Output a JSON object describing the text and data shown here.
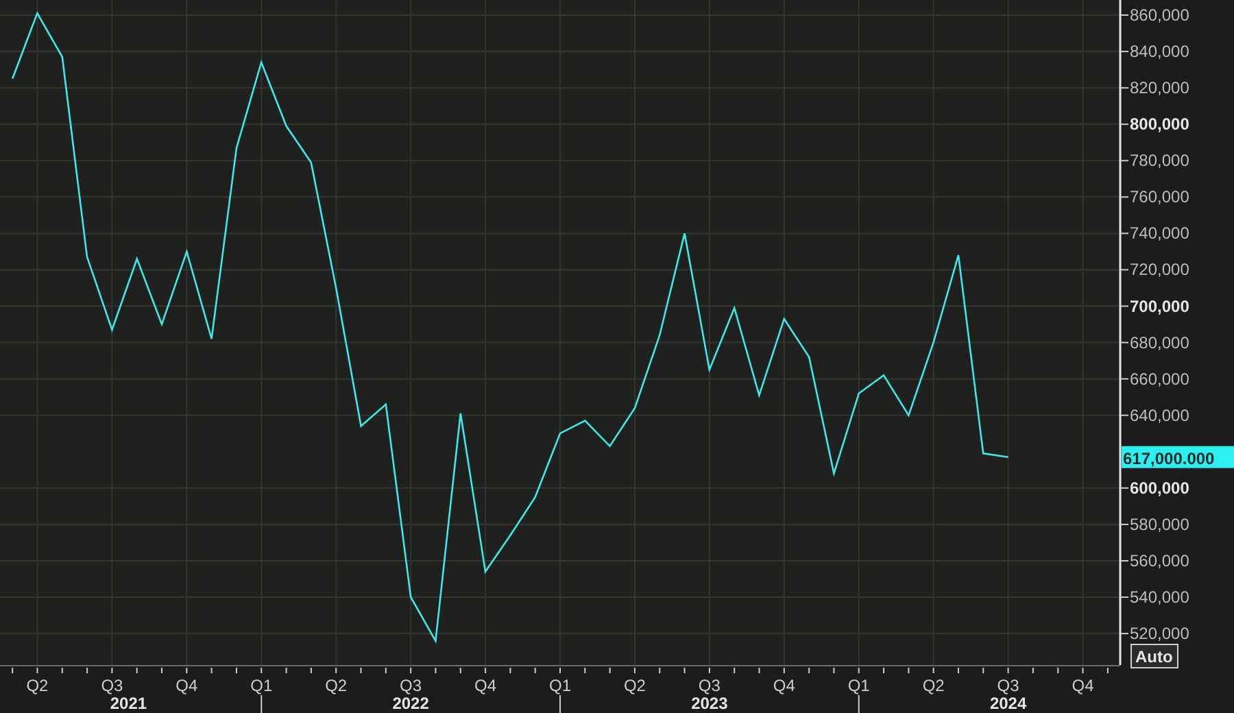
{
  "chart": {
    "chart_data": {
      "type": "line",
      "categories": [
        null,
        "Q2",
        null,
        null,
        "Q3",
        null,
        null,
        "Q4",
        null,
        null,
        "Q1",
        null,
        null,
        "Q2",
        null,
        null,
        "Q3",
        null,
        null,
        "Q4",
        null,
        null,
        "Q1",
        null,
        null,
        "Q2",
        null,
        null,
        "Q3",
        null,
        null,
        "Q4",
        null,
        null,
        "Q1",
        null,
        null,
        "Q2",
        null,
        null,
        "Q3",
        null,
        null,
        "Q4",
        null
      ],
      "series": [
        {
          "color": "#3ee8e8",
          "values": [
            825000,
            861000,
            837000,
            727000,
            687000,
            726000,
            690000,
            730000,
            682000,
            787000,
            834000,
            799000,
            779000,
            710000,
            634000,
            646000,
            540000,
            516000,
            641000,
            554000,
            574000,
            595000,
            630000,
            637000,
            623000,
            644000,
            684000,
            740000,
            665000,
            699000,
            651000,
            693000,
            672000,
            608000,
            652000,
            662000,
            640000,
            680000,
            728000,
            619000,
            617000,
            null,
            null,
            null,
            null
          ]
        }
      ],
      "grid": true,
      "ylim": [
        502700,
        868300
      ],
      "yticks": [
        {
          "value": 860000,
          "label": "860,000"
        },
        {
          "value": 840000,
          "label": "840,000"
        },
        {
          "value": 820000,
          "label": "820,000"
        },
        {
          "value": 800000,
          "label": "800,000"
        },
        {
          "value": 780000,
          "label": "780,000"
        },
        {
          "value": 760000,
          "label": "760,000"
        },
        {
          "value": 740000,
          "label": "740,000"
        },
        {
          "value": 720000,
          "label": "720,000"
        },
        {
          "value": 700000,
          "label": "700,000"
        },
        {
          "value": 680000,
          "label": "680,000"
        },
        {
          "value": 660000,
          "label": "660,000"
        },
        {
          "value": 640000,
          "label": "640,000"
        },
        {
          "value": 600000,
          "label": "600,000"
        },
        {
          "value": 580000,
          "label": "580,000"
        },
        {
          "value": 560000,
          "label": "560,000"
        },
        {
          "value": 540000,
          "label": "540,000"
        },
        {
          "value": 520000,
          "label": "520,000"
        }
      ]
    },
    "year_labels": [
      "2021",
      "2022",
      "2023",
      "2024"
    ],
    "last_value_label": "617,000.000",
    "scale_button": "Auto"
  }
}
